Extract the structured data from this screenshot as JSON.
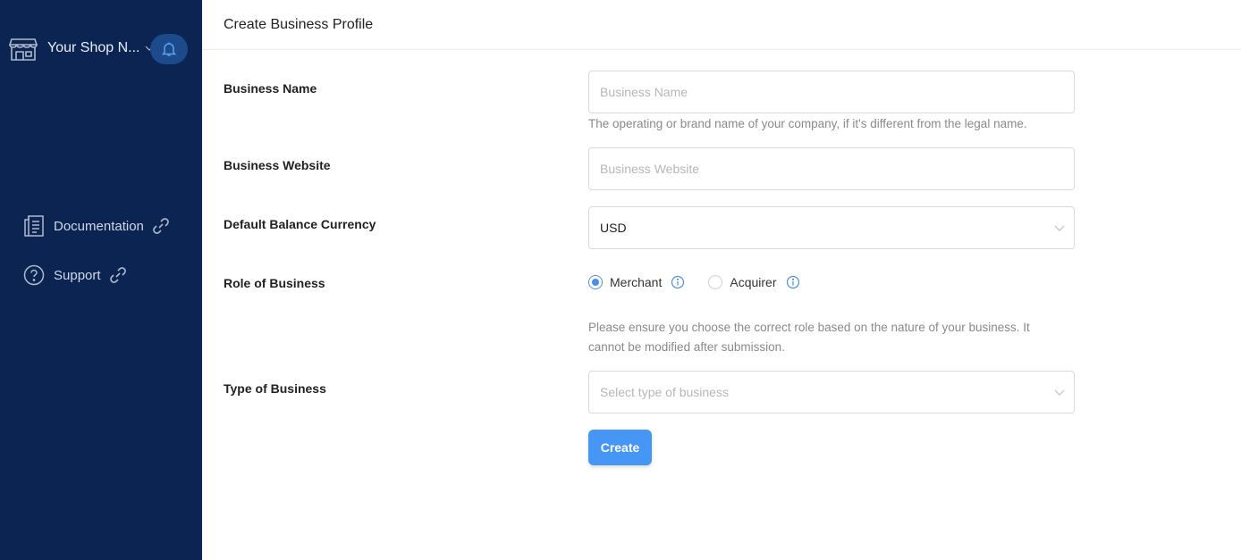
{
  "sidebar": {
    "shop_name": "Your Shop N...",
    "nav": [
      {
        "label": "Documentation",
        "icon": "document-icon"
      },
      {
        "label": "Support",
        "icon": "help-circle-icon"
      }
    ]
  },
  "page": {
    "title": "Create Business Profile"
  },
  "form": {
    "business_name": {
      "label": "Business Name",
      "placeholder": "Business Name",
      "help": "The operating or brand name of your company, if it's different from the legal name."
    },
    "business_website": {
      "label": "Business Website",
      "placeholder": "Business Website"
    },
    "currency": {
      "label": "Default Balance Currency",
      "value": "USD"
    },
    "role": {
      "label": "Role of Business",
      "options": [
        {
          "label": "Merchant",
          "selected": true
        },
        {
          "label": "Acquirer",
          "selected": false
        }
      ],
      "help": "Please ensure you choose the correct role based on the nature of your business. It cannot be modified after submission."
    },
    "type": {
      "label": "Type of Business",
      "placeholder": "Select type of business"
    },
    "submit_label": "Create"
  },
  "colors": {
    "sidebar_bg": "#0c2452",
    "accent": "#4596f5"
  }
}
